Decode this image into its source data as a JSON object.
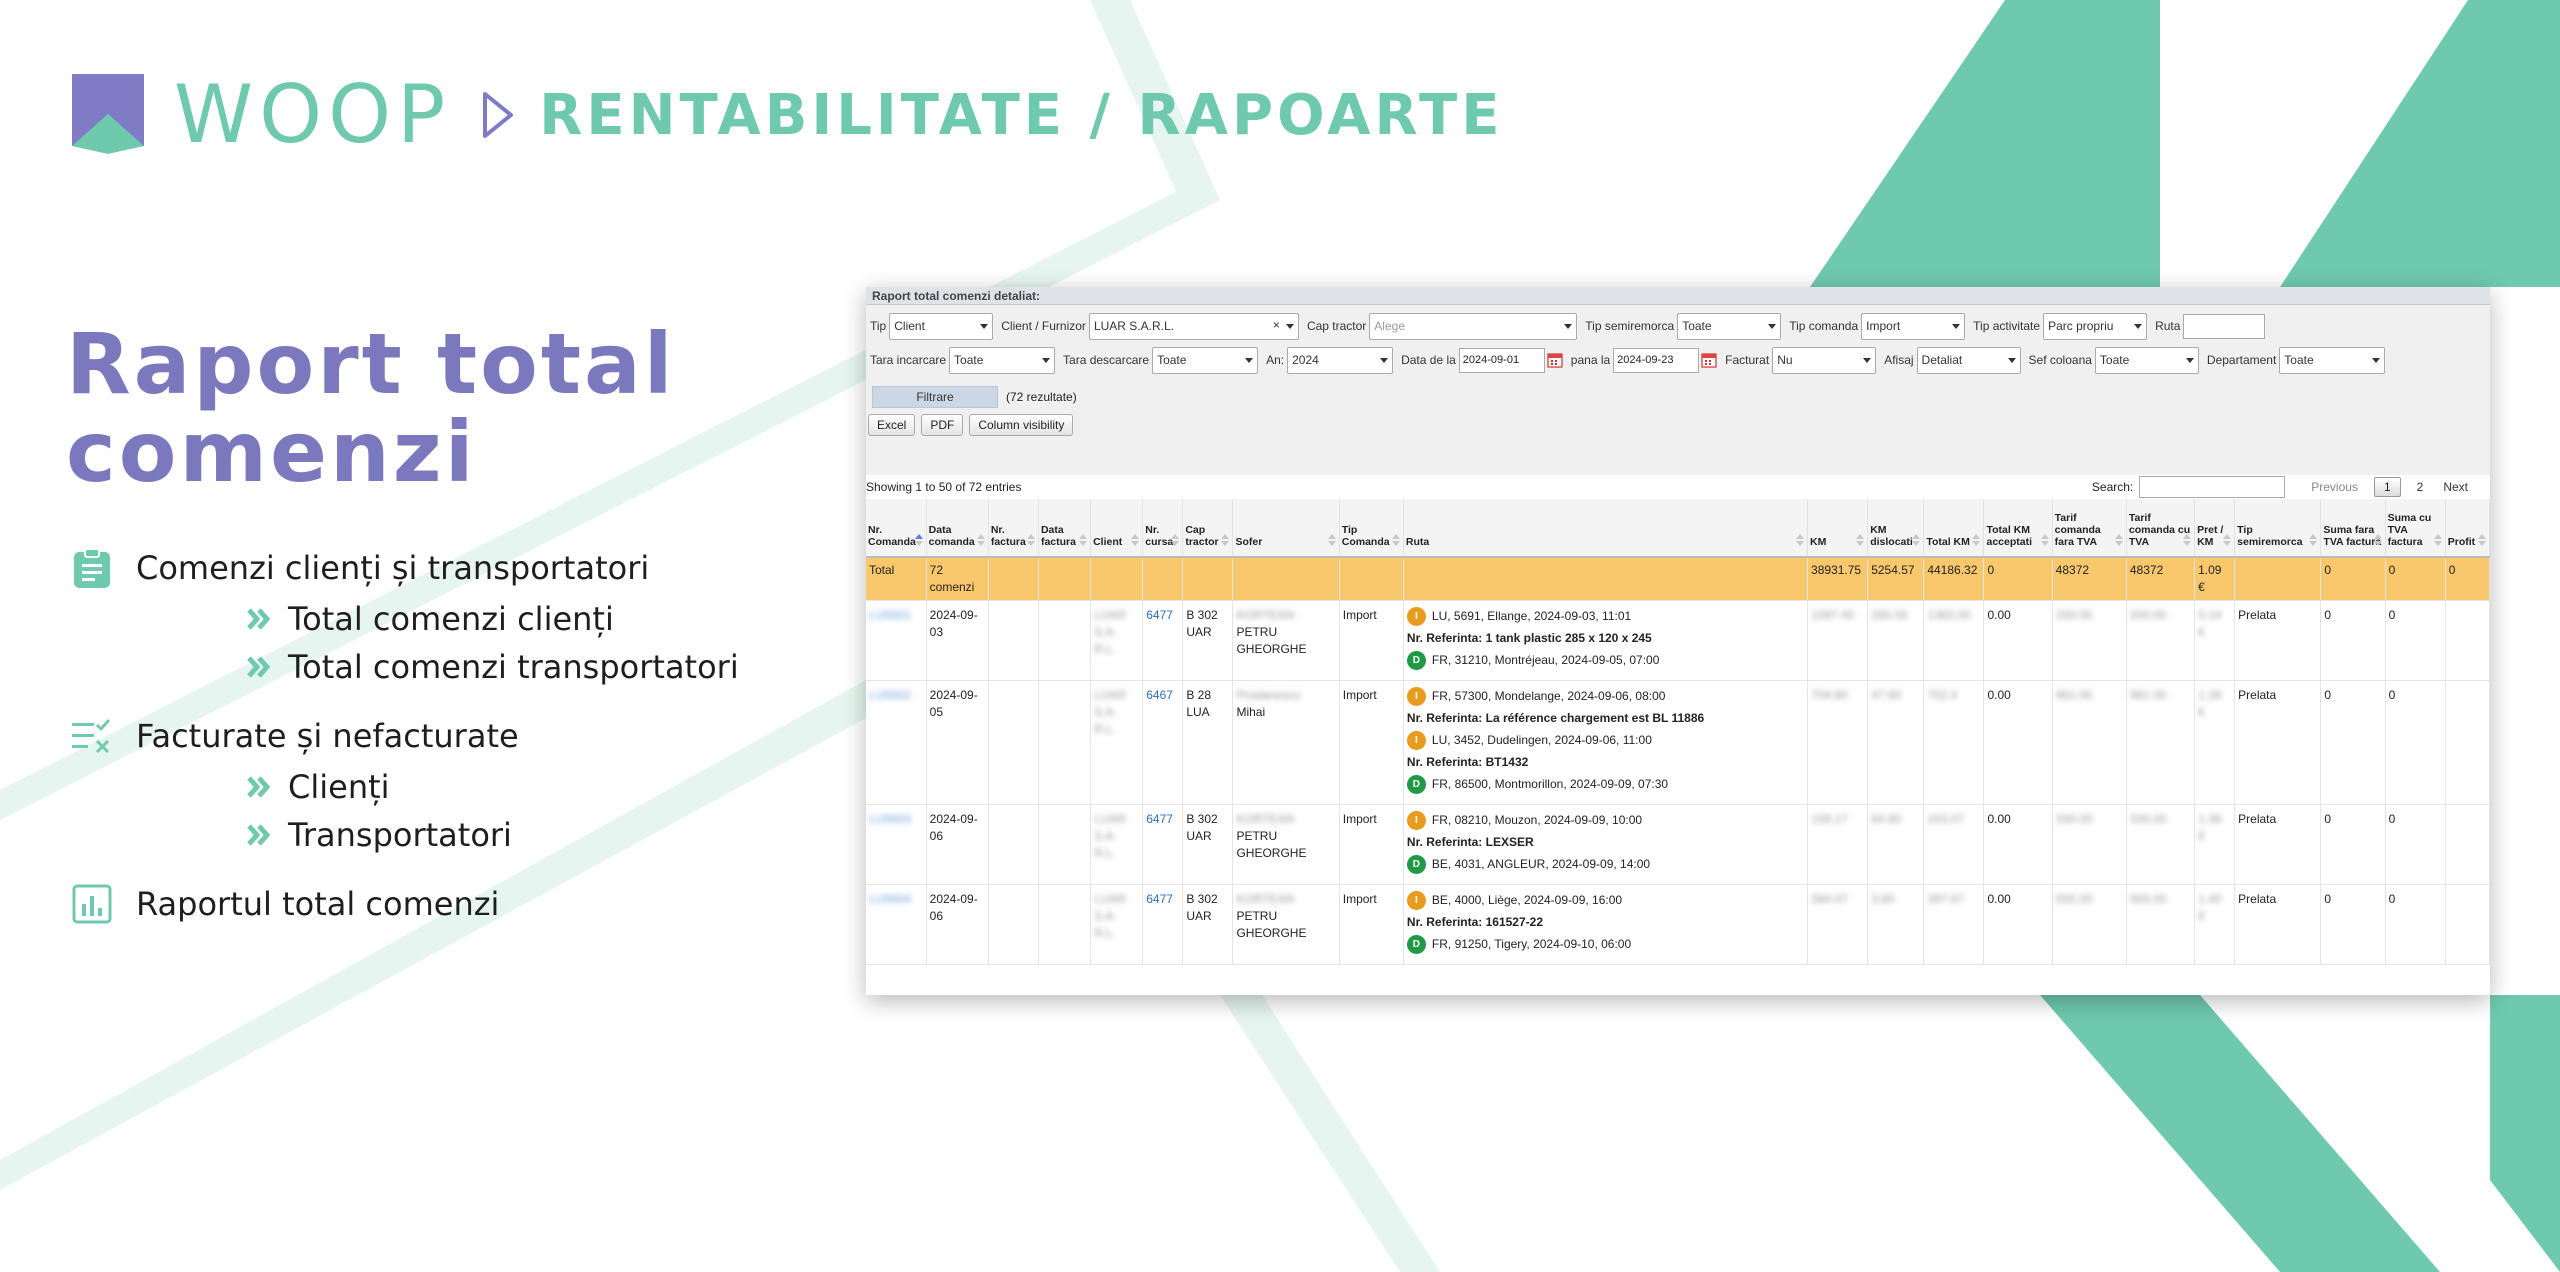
{
  "brand": {
    "name": "WOOP",
    "colors": {
      "mint": "#6fc9ad",
      "purple": "#7b78be",
      "logo_purple": "#7f7bc4"
    }
  },
  "breadcrumb": {
    "section": "RENTABILITATE / RAPOARTE"
  },
  "title": {
    "line1": "Raport total",
    "line2": "comenzi"
  },
  "features": [
    {
      "icon": "clipboard-icon",
      "label": "Comenzi clienți și transportatori",
      "subs": [
        "Total comenzi clienți",
        "Total comenzi transportatori"
      ]
    },
    {
      "icon": "checklist-icon",
      "label": "Facturate și nefacturate",
      "subs": [
        "Clienți",
        "Transportatori"
      ]
    },
    {
      "icon": "bar-chart-icon",
      "label": "Raportul total comenzi",
      "subs": []
    }
  ],
  "report": {
    "title": "Raport total comenzi detaliat:",
    "filters": {
      "tip": {
        "label": "Tip",
        "value": "Client"
      },
      "client": {
        "label": "Client / Furnizor",
        "value": "LUAR S.A.R.L."
      },
      "cap_tractor": {
        "label": "Cap tractor",
        "placeholder": "Alege"
      },
      "tip_semiremorca": {
        "label": "Tip semiremorca",
        "value": "Toate"
      },
      "tip_comanda": {
        "label": "Tip comanda",
        "value": "Import"
      },
      "tip_activitate": {
        "label": "Tip activitate",
        "value": "Parc propriu"
      },
      "ruta": {
        "label": "Ruta",
        "value": ""
      },
      "tara_incarcare": {
        "label": "Tara incarcare",
        "value": "Toate"
      },
      "tara_descarcare": {
        "label": "Tara descarcare",
        "value": "Toate"
      },
      "an": {
        "label": "An:",
        "value": "2024"
      },
      "data_de_la": {
        "label": "Data de la",
        "value": "2024-09-01"
      },
      "pana_la": {
        "label": "pana la",
        "value": "2024-09-23"
      },
      "facturat": {
        "label": "Facturat",
        "value": "Nu"
      },
      "afisaj": {
        "label": "Afisaj",
        "value": "Detaliat"
      },
      "sef_coloana": {
        "label": "Sef coloana",
        "value": "Toate"
      },
      "departament": {
        "label": "Departament",
        "value": "Toate"
      }
    },
    "filter_button": "Filtrare",
    "result_count": "(72 rezultate)",
    "buttons": {
      "excel": "Excel",
      "pdf": "PDF",
      "colvis": "Column visibility"
    },
    "showing": "Showing 1 to 50 of 72 entries",
    "search_label": "Search:",
    "pagination": {
      "previous": "Previous",
      "pages": [
        "1",
        "2"
      ],
      "next": "Next"
    },
    "columns": [
      "Nr. Comanda",
      "Data comanda",
      "Nr. factura",
      "Data factura",
      "Client",
      "Nr. cursa",
      "Cap tractor",
      "Sofer",
      "Tip Comanda",
      "Ruta",
      "KM",
      "KM dislocati",
      "Total KM",
      "Total KM acceptati",
      "Tarif comanda fara TVA",
      "Tarif comanda cu TVA",
      "Pret / KM",
      "Tip semiremorca",
      "Suma fara TVA factura",
      "Suma cu TVA factura",
      "Profit"
    ],
    "total_row": {
      "label": "Total",
      "data_comanda": "72 comenzi",
      "km": "38931.75",
      "km_dislocati": "5254.57",
      "total_km": "44186.32",
      "km_acceptati": "0",
      "tarif_fara": "48372",
      "tarif_cu": "48372",
      "pret_km": "1.09 €",
      "suma_fara": "0",
      "suma_cu": "0",
      "profit": "0"
    },
    "rows": [
      {
        "nr": "LU0001",
        "data": "2024-09-03",
        "client": "LUAR S.A. R.L.",
        "cursa": "6477",
        "cap": "B 302 UAR",
        "sofer_name": "KORTEAN",
        "sofer": "PETRU GHEORGHE",
        "tip": "Import",
        "route": [
          {
            "t": "I",
            "text": "LU, 5691, Ellange, 2024-09-03, 11:01"
          },
          {
            "ref": "Nr. Referinta: 1 tank plastic 285 x 120 x 245"
          },
          {
            "t": "D",
            "text": "FR, 31210, Montréjeau, 2024-09-05, 07:00"
          }
        ],
        "km": "1097.45",
        "kmd": "285.55",
        "tkm": "1383.00",
        "kma": "0.00",
        "tf": "200.00",
        "tc": "200.00",
        "pk": "0.14 €",
        "semi": "Prelata",
        "sf": "0",
        "sc": "0",
        "profit": ""
      },
      {
        "nr": "LU0002",
        "data": "2024-09-05",
        "client": "LUAR S.A. R.L.",
        "cursa": "6467",
        "cap": "B 28 LUA",
        "sofer_name": "Prodanescu",
        "sofer": "Mihai",
        "tip": "Import",
        "route": [
          {
            "t": "I",
            "text": "FR, 57300, Mondelange, 2024-09-06, 08:00"
          },
          {
            "ref": "Nr. Referinta: La référence chargement est BL 11886"
          },
          {
            "t": "I",
            "text": "LU, 3452, Dudelingen, 2024-09-06, 11:00"
          },
          {
            "ref": "Nr. Referinta: BT1432"
          },
          {
            "t": "D",
            "text": "FR, 86500, Montmorillon, 2024-09-09, 07:30"
          }
        ],
        "km": "704.80",
        "kmd": "47.60",
        "tkm": "752.4",
        "kma": "0.00",
        "tf": "961.00",
        "tc": "961.00",
        "pk": "1.28 €",
        "semi": "Prelata",
        "sf": "0",
        "sc": "0",
        "profit": ""
      },
      {
        "nr": "LU0003",
        "data": "2024-09-06",
        "client": "LUAR S.A. R.L.",
        "cursa": "6477",
        "cap": "B 302 UAR",
        "sofer_name": "KORTEAN",
        "sofer": "PETRU GHEORGHE",
        "tip": "Import",
        "route": [
          {
            "t": "I",
            "text": "FR, 08210, Mouzon, 2024-09-09, 10:00"
          },
          {
            "ref": "Nr. Referinta: LEXSER"
          },
          {
            "t": "D",
            "text": "BE, 4031, ANGLEUR, 2024-09-09, 14:00"
          }
        ],
        "km": "158.17",
        "kmd": "84.90",
        "tkm": "243.07",
        "kma": "0.00",
        "tf": "330.00",
        "tc": "330.00",
        "pk": "1.36 €",
        "semi": "Prelata",
        "sf": "0",
        "sc": "0",
        "profit": ""
      },
      {
        "nr": "LU0004",
        "data": "2024-09-06",
        "client": "LUAR S.A. R.L.",
        "cursa": "6477",
        "cap": "B 302 UAR",
        "sofer_name": "KORTEAN",
        "sofer": "PETRU GHEORGHE",
        "tip": "Import",
        "route": [
          {
            "t": "I",
            "text": "BE, 4000, Liège, 2024-09-09, 16:00"
          },
          {
            "ref": "Nr. Referinta: 161527-22"
          },
          {
            "t": "D",
            "text": "FR, 91250, Tigery, 2024-09-10, 06:00"
          }
        ],
        "km": "394.07",
        "kmd": "3.60",
        "tkm": "397.67",
        "kma": "0.00",
        "tf": "555.00",
        "tc": "555.00",
        "pk": "1.40 €",
        "semi": "Prelata",
        "sf": "0",
        "sc": "0",
        "profit": ""
      }
    ]
  }
}
